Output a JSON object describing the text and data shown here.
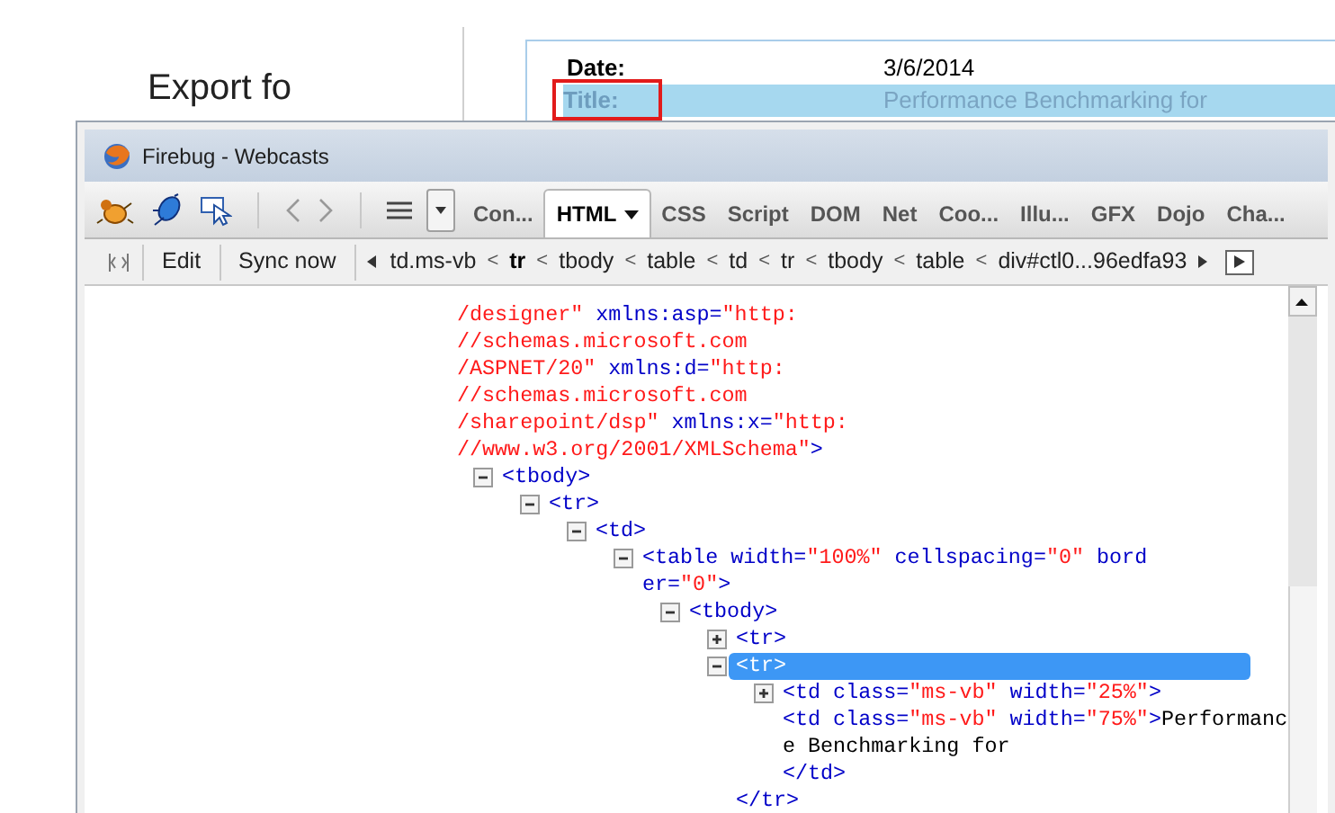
{
  "page": {
    "heading": "Export fo",
    "details": [
      {
        "label": "Date:",
        "value": "3/6/2014",
        "selected": false
      },
      {
        "label": "Title:",
        "value": "Performance Benchmarking for",
        "selected": true
      }
    ]
  },
  "window": {
    "title": "Firebug - Webcasts"
  },
  "tabs": [
    {
      "label": "Con...",
      "selected": false,
      "menu": false
    },
    {
      "label": "HTML",
      "selected": true,
      "menu": true
    },
    {
      "label": "CSS",
      "selected": false,
      "menu": false
    },
    {
      "label": "Script",
      "selected": false,
      "menu": false
    },
    {
      "label": "DOM",
      "selected": false,
      "menu": false
    },
    {
      "label": "Net",
      "selected": false,
      "menu": false
    },
    {
      "label": "Coo...",
      "selected": false,
      "menu": false
    },
    {
      "label": "Illu...",
      "selected": false,
      "menu": false
    },
    {
      "label": "GFX",
      "selected": false,
      "menu": false
    },
    {
      "label": "Dojo",
      "selected": false,
      "menu": false
    },
    {
      "label": "Cha...",
      "selected": false,
      "menu": false
    }
  ],
  "html_toolbar": {
    "buttons": [
      "Edit",
      "Sync now"
    ],
    "breadcrumbs": [
      {
        "label": "td.ms-vb",
        "selected": false,
        "sep": "<"
      },
      {
        "label": "tr",
        "selected": true,
        "sep": "<"
      },
      {
        "label": "tbody",
        "selected": false,
        "sep": "<"
      },
      {
        "label": "table",
        "selected": false,
        "sep": "<"
      },
      {
        "label": "td",
        "selected": false,
        "sep": "<"
      },
      {
        "label": "tr",
        "selected": false,
        "sep": "<"
      },
      {
        "label": "tbody",
        "selected": false,
        "sep": "<"
      },
      {
        "label": "table",
        "selected": false,
        "sep": "<"
      },
      {
        "label": "div#ctl0...96edfa93",
        "selected": false
      }
    ]
  },
  "dom_tree": {
    "lines": [
      [
        {
          "kind": "value",
          "text": "/designer\""
        },
        {
          "kind": "markup",
          "text": " xmlns:asp="
        },
        {
          "kind": "value",
          "text": "\"http:"
        }
      ],
      [
        {
          "kind": "value",
          "text": "//schemas.microsoft.com"
        }
      ],
      [
        {
          "kind": "value",
          "text": "/ASPNET/20\""
        },
        {
          "kind": "markup",
          "text": " xmlns:d="
        },
        {
          "kind": "value",
          "text": "\"http:"
        }
      ],
      [
        {
          "kind": "value",
          "text": "//schemas.microsoft.com"
        }
      ],
      [
        {
          "kind": "value",
          "text": "/sharepoint/dsp\""
        },
        {
          "kind": "markup",
          "text": " xmlns:x="
        },
        {
          "kind": "value",
          "text": "\"http:"
        }
      ],
      [
        {
          "kind": "value",
          "text": "//www.w3.org/2001/XMLSchema\""
        },
        {
          "kind": "markup",
          "text": ">"
        }
      ]
    ],
    "children": [
      {
        "expanded": true,
        "selected": false,
        "lines": [
          [
            {
              "kind": "markup",
              "text": "<tbody>"
            }
          ]
        ],
        "children": [
          {
            "expanded": true,
            "selected": false,
            "lines": [
              [
                {
                  "kind": "markup",
                  "text": "<tr>"
                }
              ]
            ],
            "children": [
              {
                "expanded": true,
                "selected": false,
                "lines": [
                  [
                    {
                      "kind": "markup",
                      "text": "<td>"
                    }
                  ]
                ],
                "children": [
                  {
                    "expanded": true,
                    "selected": false,
                    "lines": [
                      [
                        {
                          "kind": "markup",
                          "text": "<table width="
                        },
                        {
                          "kind": "value",
                          "text": "\"100%\""
                        },
                        {
                          "kind": "markup",
                          "text": " cellspacing="
                        },
                        {
                          "kind": "value",
                          "text": "\"0\""
                        },
                        {
                          "kind": "markup",
                          "text": " bord"
                        }
                      ],
                      [
                        {
                          "kind": "markup",
                          "text": "er="
                        },
                        {
                          "kind": "value",
                          "text": "\"0\""
                        },
                        {
                          "kind": "markup",
                          "text": ">"
                        }
                      ]
                    ],
                    "children": [
                      {
                        "expanded": true,
                        "selected": false,
                        "lines": [
                          [
                            {
                              "kind": "markup",
                              "text": "<tbody>"
                            }
                          ]
                        ],
                        "children": [
                          {
                            "expanded": false,
                            "selected": false,
                            "lines": [
                              [
                                {
                                  "kind": "markup",
                                  "text": "<tr>"
                                }
                              ]
                            ]
                          },
                          {
                            "expanded": true,
                            "selected": true,
                            "lines": [
                              [
                                {
                                  "kind": "markup",
                                  "text": "<tr>"
                                }
                              ]
                            ],
                            "closing": "</tr>",
                            "children": [
                              {
                                "expanded": false,
                                "selected": false,
                                "lines": [
                                  [
                                    {
                                      "kind": "markup",
                                      "text": "<td class="
                                    },
                                    {
                                      "kind": "value",
                                      "text": "\"ms-vb\""
                                    },
                                    {
                                      "kind": "markup",
                                      "text": " width="
                                    },
                                    {
                                      "kind": "value",
                                      "text": "\"25%\""
                                    },
                                    {
                                      "kind": "markup",
                                      "text": ">"
                                    }
                                  ]
                                ]
                              },
                              {
                                "selected": false,
                                "lines": [
                                  [
                                    {
                                      "kind": "markup",
                                      "text": "<td class="
                                    },
                                    {
                                      "kind": "value",
                                      "text": "\"ms-vb\""
                                    },
                                    {
                                      "kind": "markup",
                                      "text": " width="
                                    },
                                    {
                                      "kind": "value",
                                      "text": "\"75%\""
                                    },
                                    {
                                      "kind": "markup",
                                      "text": ">"
                                    },
                                    {
                                      "kind": "text",
                                      "text": "Performanc"
                                    }
                                  ],
                                  [
                                    {
                                      "kind": "text",
                                      "text": "e Benchmarking for"
                                    }
                                  ],
                                  [
                                    {
                                      "kind": "markup",
                                      "text": "</td>"
                                    }
                                  ]
                                ]
                              }
                            ]
                          }
                        ]
                      }
                    ]
                  }
                ]
              }
            ]
          }
        ]
      }
    ]
  }
}
